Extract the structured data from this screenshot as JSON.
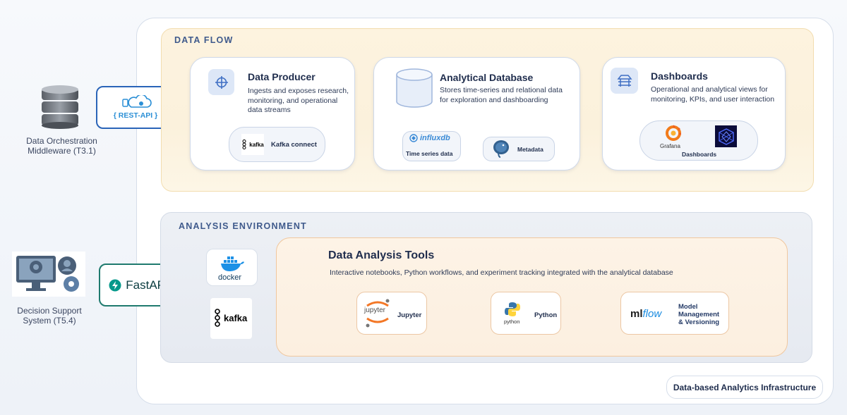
{
  "infrastructure_label": "Data-based Analytics Infrastructure",
  "left_systems": {
    "middleware": {
      "label_line1": "Data Orchestration",
      "label_line2": "Middleware (T3.1)",
      "api_label": "{ REST-API }"
    },
    "dss": {
      "label_line1": "Decision Support",
      "label_line2": "System (T5.4)",
      "api_label": "FastAPI"
    }
  },
  "data_flow": {
    "title": "DATA FLOW",
    "producer": {
      "title": "Data Producer",
      "desc_lines": [
        "Ingests and exposes research,",
        "monitoring, and operational",
        "data streams"
      ],
      "tool": "Kafka connect",
      "logo_text": "kafka"
    },
    "database": {
      "title": "Analytical Database",
      "desc_lines": [
        "Stores time-series and relational data",
        "for exploration and dashboarding"
      ],
      "influx_logo": "influxdb",
      "influx_label": "Time series data",
      "pg_label": "Metadata"
    },
    "dashboards": {
      "title": "Dashboards",
      "desc_lines": [
        "Operational and analytical views for",
        "monitoring, KPIs, and user interaction"
      ],
      "grafana_logo": "Grafana",
      "label": "Dashboards"
    }
  },
  "analysis": {
    "title": "ANALYSIS ENVIRONMENT",
    "docker_label": "docker",
    "kafka_label": "kafka",
    "tools": {
      "title": "Data Analysis Tools",
      "desc": "Interactive notebooks, Python workflows, and experiment tracking integrated with the analytical database",
      "jupyter_logo": "jupyter",
      "jupyter_label": "Jupyter",
      "python_logo": "python",
      "python_label": "Python",
      "mlflow_logo_a": "ml",
      "mlflow_logo_b": "flow",
      "mlflow_label_lines": [
        "Model",
        "Management",
        "& Versioning"
      ]
    }
  }
}
